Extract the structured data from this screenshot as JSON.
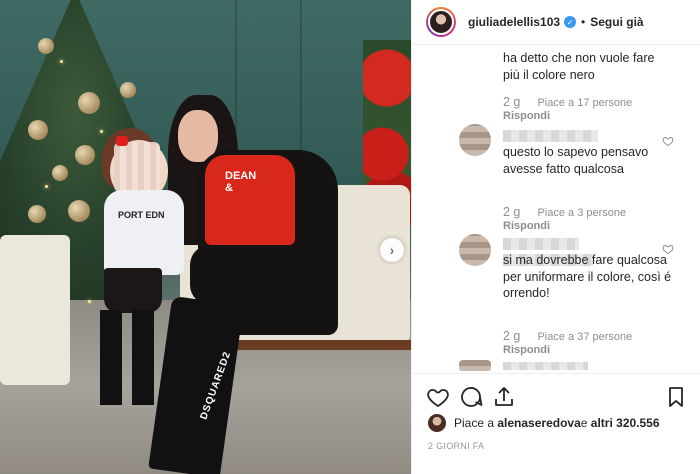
{
  "post": {
    "username": "giuliadelellis103",
    "follow_state": "Segui già",
    "separator": "•",
    "shirt_print": "DEAN\n&",
    "sweater_print": "PORT EDN",
    "boot_print": "DSQUARED2"
  },
  "comments": [
    {
      "text": "ha detto che non vuole fare più il colore nero",
      "time": "2 g",
      "likes": "Piace a 17 persone",
      "reply": "Rispondi"
    },
    {
      "text": "questo lo sapevo pensavo avesse fatto qualcosa",
      "time": "2 g",
      "likes": "Piace a 3 persone",
      "reply": "Rispondi"
    },
    {
      "text": "si ma dovrebbe fare qualcosa per uniformare il colore, così é orrendo!",
      "time": "2 g",
      "likes": "Piace a 37 persone",
      "reply": "Rispondi"
    }
  ],
  "likes": {
    "prefix": "Piace a ",
    "user": "alenaseredova",
    "middle": " e ",
    "others": "altri 320.556"
  },
  "date": "2 GIORNI FA",
  "icons": {
    "verified": "verified-badge-icon",
    "like": "heart-icon",
    "comment": "comment-bubble-icon",
    "share": "share-upload-icon",
    "save": "bookmark-icon",
    "next": "chevron-right-icon"
  },
  "colors": {
    "verified": "#3897f0",
    "text": "#262626",
    "muted": "#8e8e8e",
    "border": "#efefef"
  }
}
